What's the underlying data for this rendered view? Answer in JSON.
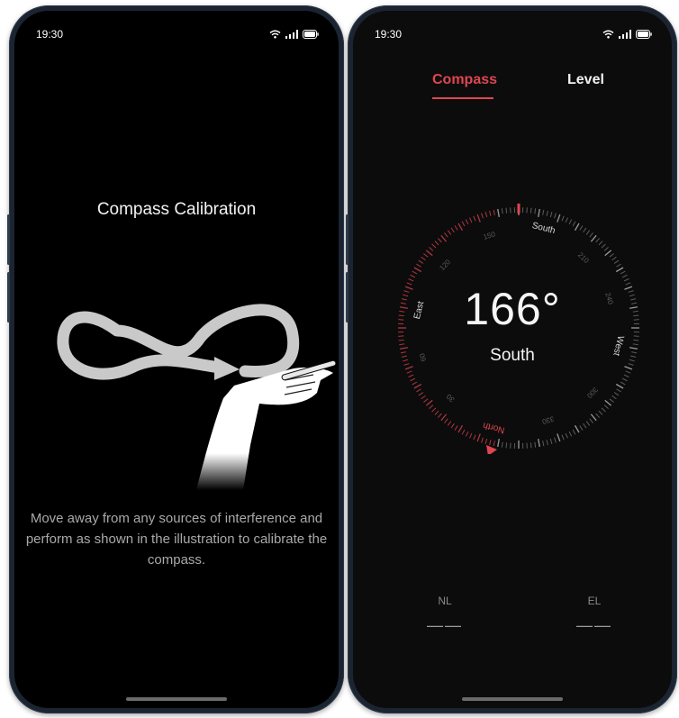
{
  "left_screen": {
    "status_time": "19:30",
    "title": "Compass Calibration",
    "description": "Move away from any sources of interference and perform as shown in the illustration to calibrate the compass."
  },
  "right_screen": {
    "status_time": "19:30",
    "tabs": [
      {
        "label": "Compass",
        "active": true
      },
      {
        "label": "Level",
        "active": false
      }
    ],
    "heading_degrees": "166°",
    "heading_direction": "South",
    "dial_labels": [
      "South",
      "West",
      "North",
      "East"
    ],
    "dial_numbers": [
      "150",
      "120",
      "210",
      "240",
      "60",
      "30",
      "300",
      "330"
    ],
    "nl_label": "NL",
    "nl_value": "——",
    "el_label": "EL",
    "el_value": "——"
  },
  "colors": {
    "accent": "#e0464f",
    "frame": "#1b2430",
    "screen_bg": "#000000"
  }
}
